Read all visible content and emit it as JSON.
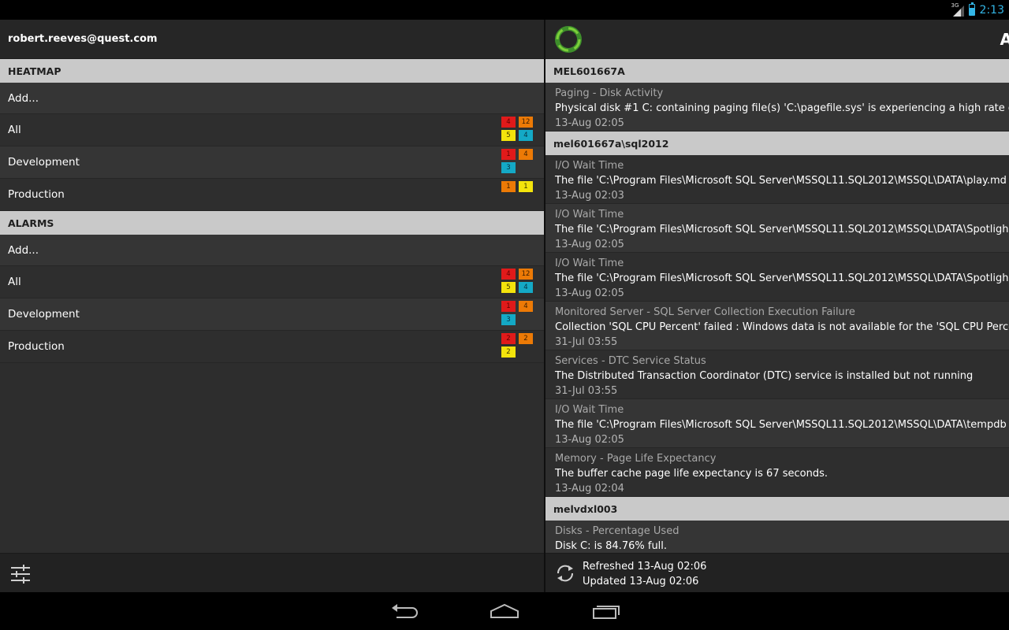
{
  "status_bar": {
    "network": "3G",
    "time": "2:13"
  },
  "left": {
    "account": "robert.reeves@quest.com",
    "heatmap": {
      "header": "HEATMAP",
      "add_label": "Add...",
      "items": [
        {
          "label": "All",
          "badges": [
            {
              "value": "4",
              "color": "red"
            },
            {
              "value": "12",
              "color": "orange"
            },
            {
              "value": "5",
              "color": "yellow"
            },
            {
              "value": "4",
              "color": "teal"
            }
          ]
        },
        {
          "label": "Development",
          "badges": [
            {
              "value": "1",
              "color": "red"
            },
            {
              "value": "4",
              "color": "orange"
            },
            {
              "value": "3",
              "color": "teal"
            }
          ]
        },
        {
          "label": "Production",
          "badges": [
            {
              "value": "1",
              "color": "orange"
            },
            {
              "value": "1",
              "color": "yellow"
            }
          ]
        }
      ]
    },
    "alarms": {
      "header": "ALARMS",
      "add_label": "Add...",
      "items": [
        {
          "label": "All",
          "badges": [
            {
              "value": "4",
              "color": "red"
            },
            {
              "value": "12",
              "color": "orange"
            },
            {
              "value": "5",
              "color": "yellow"
            },
            {
              "value": "4",
              "color": "teal"
            }
          ]
        },
        {
          "label": "Development",
          "badges": [
            {
              "value": "1",
              "color": "red"
            },
            {
              "value": "4",
              "color": "orange"
            },
            {
              "value": "3",
              "color": "teal"
            }
          ]
        },
        {
          "label": "Production",
          "badges": [
            {
              "value": "2",
              "color": "red"
            },
            {
              "value": "2",
              "color": "orange"
            },
            {
              "value": "2",
              "color": "yellow"
            }
          ]
        }
      ]
    },
    "footer_icon": "settings-sliders-icon"
  },
  "right": {
    "title": "A",
    "groups": [
      {
        "server": "MEL601667A",
        "alarms": [
          {
            "title": "Paging - Disk Activity",
            "detail": "Physical disk #1 C: containing paging file(s) 'C:\\pagefile.sys' is experiencing a high rate of I/O",
            "time": "13-Aug 02:05"
          }
        ]
      },
      {
        "server": "mel601667a\\sql2012",
        "alarms": [
          {
            "title": "I/O Wait Time",
            "detail": "The file 'C:\\Program Files\\Microsoft SQL Server\\MSSQL11.SQL2012\\MSSQL\\DATA\\play.md",
            "time": "13-Aug 02:03"
          },
          {
            "title": "I/O Wait Time",
            "detail": "The file 'C:\\Program Files\\Microsoft SQL Server\\MSSQL11.SQL2012\\MSSQL\\DATA\\Spotligh",
            "time": "13-Aug 02:05"
          },
          {
            "title": "I/O Wait Time",
            "detail": "The file 'C:\\Program Files\\Microsoft SQL Server\\MSSQL11.SQL2012\\MSSQL\\DATA\\Spotligh",
            "time": "13-Aug 02:05"
          },
          {
            "title": "Monitored Server - SQL Server Collection Execution Failure",
            "detail": "Collection 'SQL CPU Percent' failed : Windows data is not available for the 'SQL CPU Percent' c",
            "time": "31-Jul 03:55"
          },
          {
            "title": "Services - DTC Service Status",
            "detail": "The Distributed Transaction Coordinator (DTC) service is installed but not running",
            "time": "31-Jul 03:55"
          },
          {
            "title": "I/O Wait Time",
            "detail": "The file 'C:\\Program Files\\Microsoft SQL Server\\MSSQL11.SQL2012\\MSSQL\\DATA\\tempdb",
            "time": "13-Aug 02:05"
          },
          {
            "title": "Memory - Page Life Expectancy",
            "detail": "The buffer cache page life expectancy is 67 seconds.",
            "time": "13-Aug 02:04"
          }
        ]
      },
      {
        "server": "melvdxl003",
        "alarms": [
          {
            "title": "Disks - Percentage Used",
            "detail": "Disk C: is 84.76% full.",
            "time": ""
          }
        ]
      }
    ],
    "footer": {
      "refreshed": "Refreshed 13-Aug 02:06",
      "updated": "Updated 13-Aug 02:06"
    }
  },
  "nav": {
    "back": "back-icon",
    "home": "home-icon",
    "recents": "recent-apps-icon"
  }
}
